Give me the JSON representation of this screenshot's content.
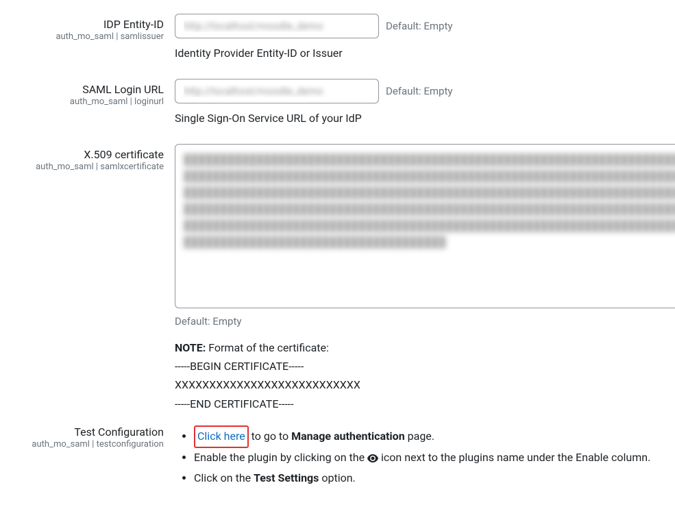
{
  "fields": {
    "idp_entity": {
      "label": "IDP Entity-ID",
      "sub": "auth_mo_saml | samlissuer",
      "value": "http://localhost/moodle_demo",
      "default_hint": "Default: Empty",
      "desc": "Identity Provider Entity-ID or Issuer"
    },
    "login_url": {
      "label": "SAML Login URL",
      "sub": "auth_mo_saml | loginurl",
      "value": "http://localhost/moodle_demo",
      "default_hint": "Default: Empty",
      "desc": "Single Sign-On Service URL of your IdP"
    },
    "x509": {
      "label": "X.509 certificate",
      "sub": "auth_mo_saml | samlxcertificate",
      "value": "████████████████████████████████████████████████████████████████████████████████████████████████████████████████████████████████████████████████████████████████████████████████████████████████████████████████████████████████████████████████████████████████████████████████████████████████████████████████████████████████████████████████████████████████████████████████████████",
      "default_hint": "Default: Empty",
      "note_label": "NOTE:",
      "note_text": " Format of the certificate:",
      "cert_begin": "-----BEGIN CERTIFICATE-----",
      "cert_body": "XXXXXXXXXXXXXXXXXXXXXXXXXXX",
      "cert_end": "-----END CERTIFICATE-----"
    },
    "test_config": {
      "label": "Test Configuration",
      "sub": "auth_mo_saml | testconfiguration",
      "step1_link": "Click here",
      "step1_a": " to go to ",
      "step1_bold": "Manage authentication",
      "step1_b": " page.",
      "step2_a": "Enable the plugin by clicking on the ",
      "step2_b": " icon next to the plugins name under the Enable column.",
      "step3_a": "Click on the ",
      "step3_bold": "Test Settings",
      "step3_b": " option."
    }
  }
}
